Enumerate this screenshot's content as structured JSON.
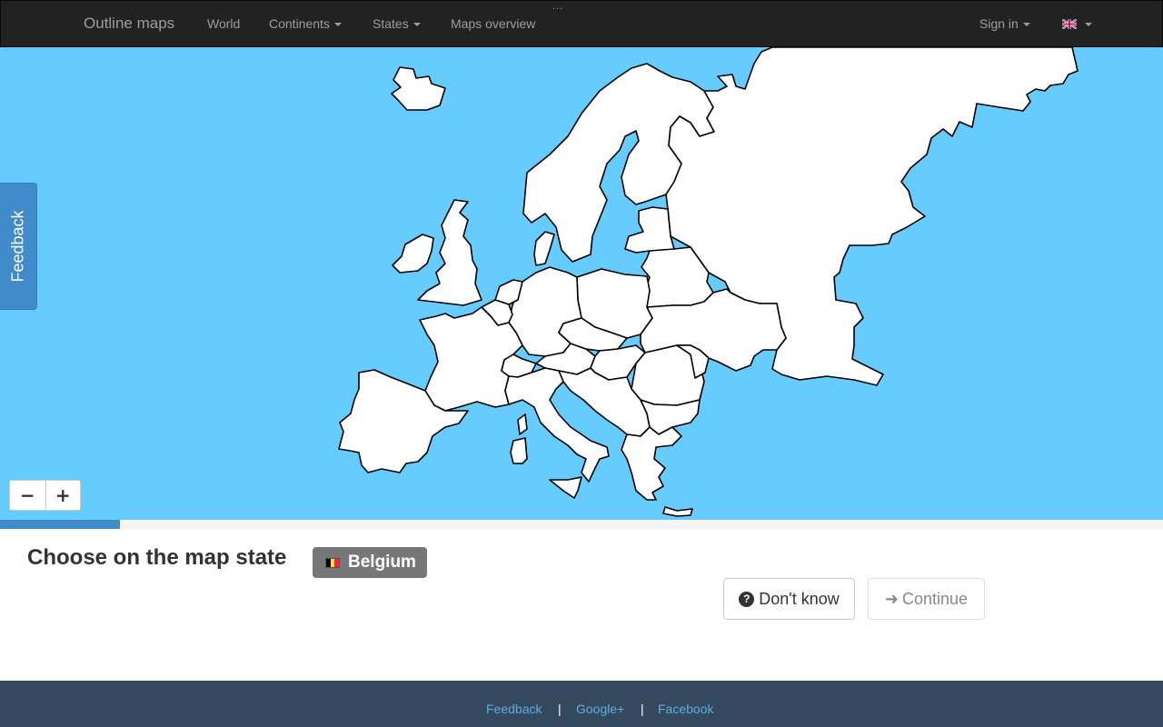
{
  "navbar": {
    "brand": "Outline maps",
    "items": [
      {
        "label": "World"
      },
      {
        "label": "Continents"
      },
      {
        "label": "States"
      },
      {
        "label": "Maps overview"
      }
    ],
    "overflow": "...",
    "sign_in": "Sign in",
    "language_icon": "uk-flag-icon"
  },
  "feedback_tab": {
    "label": "Feedback"
  },
  "map": {
    "sea_color": "#66ccff",
    "land_color": "#ffffff",
    "zoom_out": "−",
    "zoom_in": "+"
  },
  "progress": {
    "value": 0.103,
    "color": "#428bca"
  },
  "quiz": {
    "prompt": "Choose on the map state",
    "target": "Belgium",
    "target_flag_icon": "belgium-flag-icon",
    "dont_know_label": "Don't know",
    "continue_label": "Continue"
  },
  "footer": {
    "links": [
      "Feedback",
      "Google+",
      "Facebook"
    ],
    "separator": "|"
  }
}
